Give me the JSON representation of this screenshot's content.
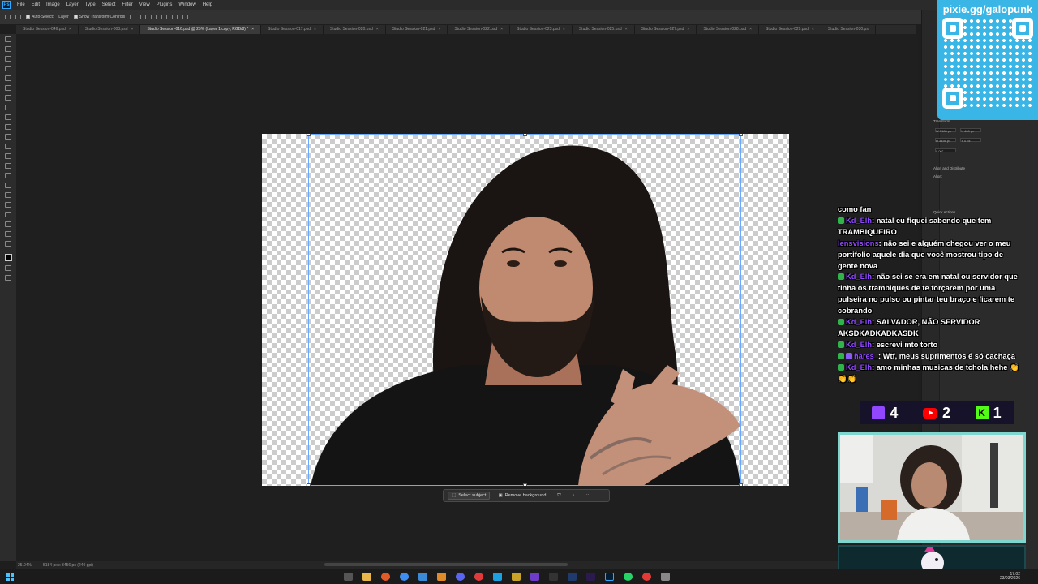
{
  "menubar": {
    "logo": "Ps",
    "items": [
      "File",
      "Edit",
      "Image",
      "Layer",
      "Type",
      "Select",
      "Filter",
      "View",
      "Plugins",
      "Window",
      "Help"
    ]
  },
  "options": {
    "auto_select": "Auto-Select:",
    "layer": "Layer",
    "show_transform": "Show Transform Controls"
  },
  "tabs": [
    {
      "label": "Studio Session-046.psd",
      "active": false
    },
    {
      "label": "Studio Session-003.psd",
      "active": false
    },
    {
      "label": "Studio Session-016.psd @ 25% (Layer 1 copy, RGB/8) *",
      "active": true
    },
    {
      "label": "Studio Session-017.psd",
      "active": false
    },
    {
      "label": "Studio Session-020.psd",
      "active": false
    },
    {
      "label": "Studio Session-021.psd",
      "active": false
    },
    {
      "label": "Studio Session-022.psd",
      "active": false
    },
    {
      "label": "Studio Session-023.psd",
      "active": false
    },
    {
      "label": "Studio Session-025.psd",
      "active": false
    },
    {
      "label": "Studio Session-027.psd",
      "active": false
    },
    {
      "label": "Studio Session-028.psd",
      "active": false
    },
    {
      "label": "Studio Session-029.psd",
      "active": false
    },
    {
      "label": "Studio Session-030.ps",
      "active": false
    }
  ],
  "context_bar": {
    "select_subject": "Select subject",
    "remove_background": "Remove background"
  },
  "status": {
    "zoom": "25.04%",
    "doc_size": "5184 px x 3456 px (240 ppi)"
  },
  "properties": {
    "transform_label": "Transform",
    "w": "W 5184 px",
    "h": "H 3456 px",
    "x": "X 460 px",
    "y": "Y 0 px",
    "angle": "0.00°",
    "align_label": "Align and Distribute",
    "align_sub": "Align:",
    "quick_actions": "Quick Actions"
  },
  "overlay": {
    "pixie_url": "pixie.gg/galopunk",
    "counts": {
      "twitch": "4",
      "youtube": "2",
      "kick": "1"
    }
  },
  "chat": [
    {
      "user": "",
      "text": "como fan"
    },
    {
      "user": "Kd_Elh",
      "text": ": natal eu fiquei sabendo que tem TRAMBIQUEIRO"
    },
    {
      "user": "lensvisions",
      "text": ": não sei e alguém chegou ver o meu portifolio aquele dia que você mostrou tipo de gente nova"
    },
    {
      "user": "Kd_Elh",
      "text": ": não sei se era em natal ou servidor que tinha os trambiques de te forçarem por uma pulseira no pulso ou pintar teu braço e ficarem te cobrando"
    },
    {
      "user": "Kd_Elh",
      "text": ": SALVADOR, NÃO SERVIDOR AKSDKADKADKASDK"
    },
    {
      "user": "Kd_Elh",
      "text": ": escrevi mto torto"
    },
    {
      "user": "hares_",
      "text": ": Wtf, meus suprimentos é só cachaça"
    },
    {
      "user": "Kd_Elh",
      "text": ": amo minhas musicas de tchola hehe 👏👏👏"
    }
  ],
  "taskbar": {
    "time": "17:02",
    "date": "23/03/2026"
  },
  "colors": {
    "accent": "#31a8ff",
    "pixie_bg": "#3ab6e6",
    "chat_user": "#9146ff"
  }
}
